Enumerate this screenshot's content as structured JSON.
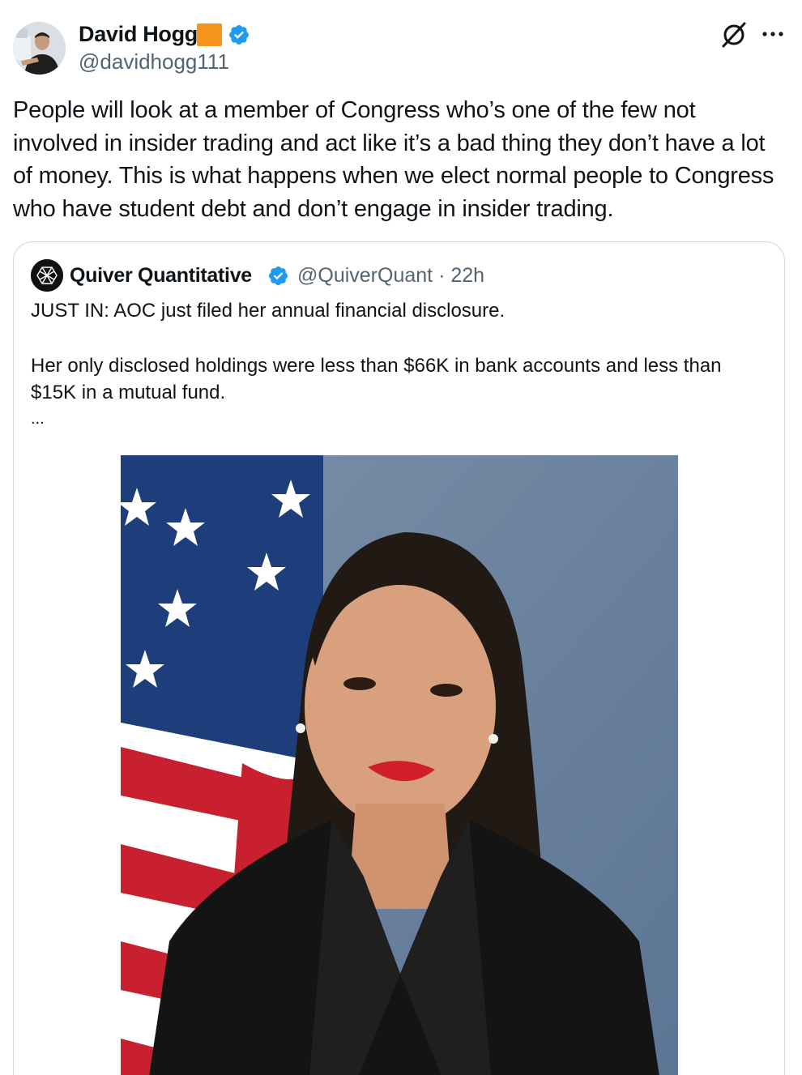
{
  "post": {
    "author_name": "David Hogg",
    "author_handle": "@davidhogg111",
    "text": "People will look at a member of Congress who’s one of the few not involved in insider trading and act like it’s a bad thing they don’t have a lot of money. This is what happens when we elect normal people to Congress who have student debt and don’t engage in insider trading.",
    "colors": {
      "verified": "#1d9bf0",
      "badge": "#f6931d",
      "secondary_text": "#536471"
    },
    "icons": [
      "verified-badge-icon",
      "grok-icon",
      "more-icon"
    ]
  },
  "quote": {
    "author_name": "Quiver Quantitative",
    "author_handle": "@QuiverQuant",
    "separator": "·",
    "time": "22h",
    "line1": "JUST IN: AOC just filed her annual financial disclosure.",
    "line2": "Her only disclosed holdings were less than $66K in bank accounts and less than $15K in a mutual fund.",
    "more": "..."
  }
}
